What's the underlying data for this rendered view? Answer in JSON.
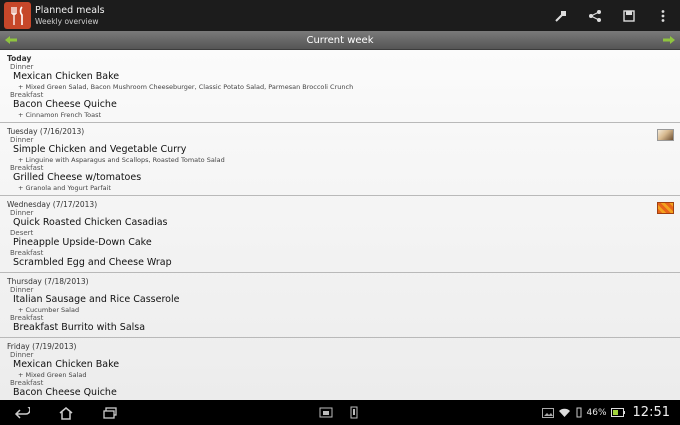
{
  "app": {
    "title": "Planned meals",
    "subtitle": "Weekly overview"
  },
  "week": {
    "title": "Current week"
  },
  "days": [
    {
      "label": "Today",
      "bold": true,
      "thumb": null,
      "meals": [
        {
          "type": "Dinner",
          "dish": "Mexican Chicken Bake",
          "sides": "+ Mixed Green Salad, Bacon Mushroom Cheeseburger, Classic Potato Salad, Parmesan Broccoli Crunch"
        },
        {
          "type": "Breakfast",
          "dish": "Bacon Cheese Quiche",
          "sides": "+ Cinnamon French Toast"
        }
      ]
    },
    {
      "label": "Tuesday (7/16/2013)",
      "bold": false,
      "thumb": "tue",
      "meals": [
        {
          "type": "Dinner",
          "dish": "Simple Chicken and Vegetable Curry",
          "sides": "+ Linguine with Asparagus and Scallops, Roasted Tomato Salad"
        },
        {
          "type": "Breakfast",
          "dish": "Grilled Cheese w/tomatoes",
          "sides": "+ Granola and Yogurt Parfait"
        }
      ]
    },
    {
      "label": "Wednesday (7/17/2013)",
      "bold": false,
      "thumb": "wed",
      "meals": [
        {
          "type": "Dinner",
          "dish": "Quick Roasted Chicken Casadias",
          "sides": ""
        },
        {
          "type": "Desert",
          "dish": "Pineapple Upside-Down Cake",
          "sides": ""
        },
        {
          "type": "Breakfast",
          "dish": "Scrambled Egg and Cheese Wrap",
          "sides": ""
        }
      ]
    },
    {
      "label": "Thursday (7/18/2013)",
      "bold": false,
      "thumb": null,
      "meals": [
        {
          "type": "Dinner",
          "dish": "Italian Sausage and Rice Casserole",
          "sides": "+ Cucumber Salad"
        },
        {
          "type": "Breakfast",
          "dish": "Breakfast Burrito with Salsa",
          "sides": ""
        }
      ]
    },
    {
      "label": "Friday (7/19/2013)",
      "bold": false,
      "thumb": null,
      "meals": [
        {
          "type": "Dinner",
          "dish": "Mexican Chicken Bake",
          "sides": "+ Mixed Green Salad"
        },
        {
          "type": "Breakfast",
          "dish": "Bacon Cheese Quiche",
          "sides": ""
        }
      ]
    }
  ],
  "status": {
    "battery": "46%",
    "time": "12:51"
  },
  "colors": {
    "accent": "#c6472a",
    "arrow": "#8fc43f"
  }
}
